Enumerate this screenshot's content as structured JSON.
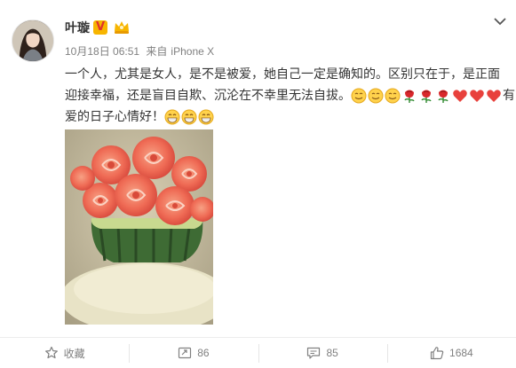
{
  "post": {
    "author": "叶璇",
    "date": "10月18日 06:51",
    "source_prefix": "来自",
    "source": "iPhone X",
    "text_line1": "一个人，尤其是女人，是不是被爱，她自己一定是确知的。区别只在于，是正面",
    "text_line2": "迎接幸福，还是盲目自欺、沉沦在不幸里无法自拔。",
    "text_line2_tail": "有",
    "text_line3": "爱的日子心情好！",
    "image_description_icon": "watermelon-carving-image"
  },
  "badges": {
    "vip_letter": "V",
    "vip_color": "#f7b500",
    "member_color": "#f7b500"
  },
  "actions": {
    "favorite_label": "收藏",
    "repost_count": "86",
    "comment_count": "85",
    "like_count": "1684"
  },
  "icons": {
    "more": "chevron-down-icon",
    "favorite": "star-icon",
    "repost": "repost-icon",
    "comment": "comment-icon",
    "like": "thumbs-up-icon"
  },
  "colors": {
    "text": "#333333",
    "meta": "#808080",
    "heart": "#e8413c",
    "rose": "#d8282c"
  }
}
